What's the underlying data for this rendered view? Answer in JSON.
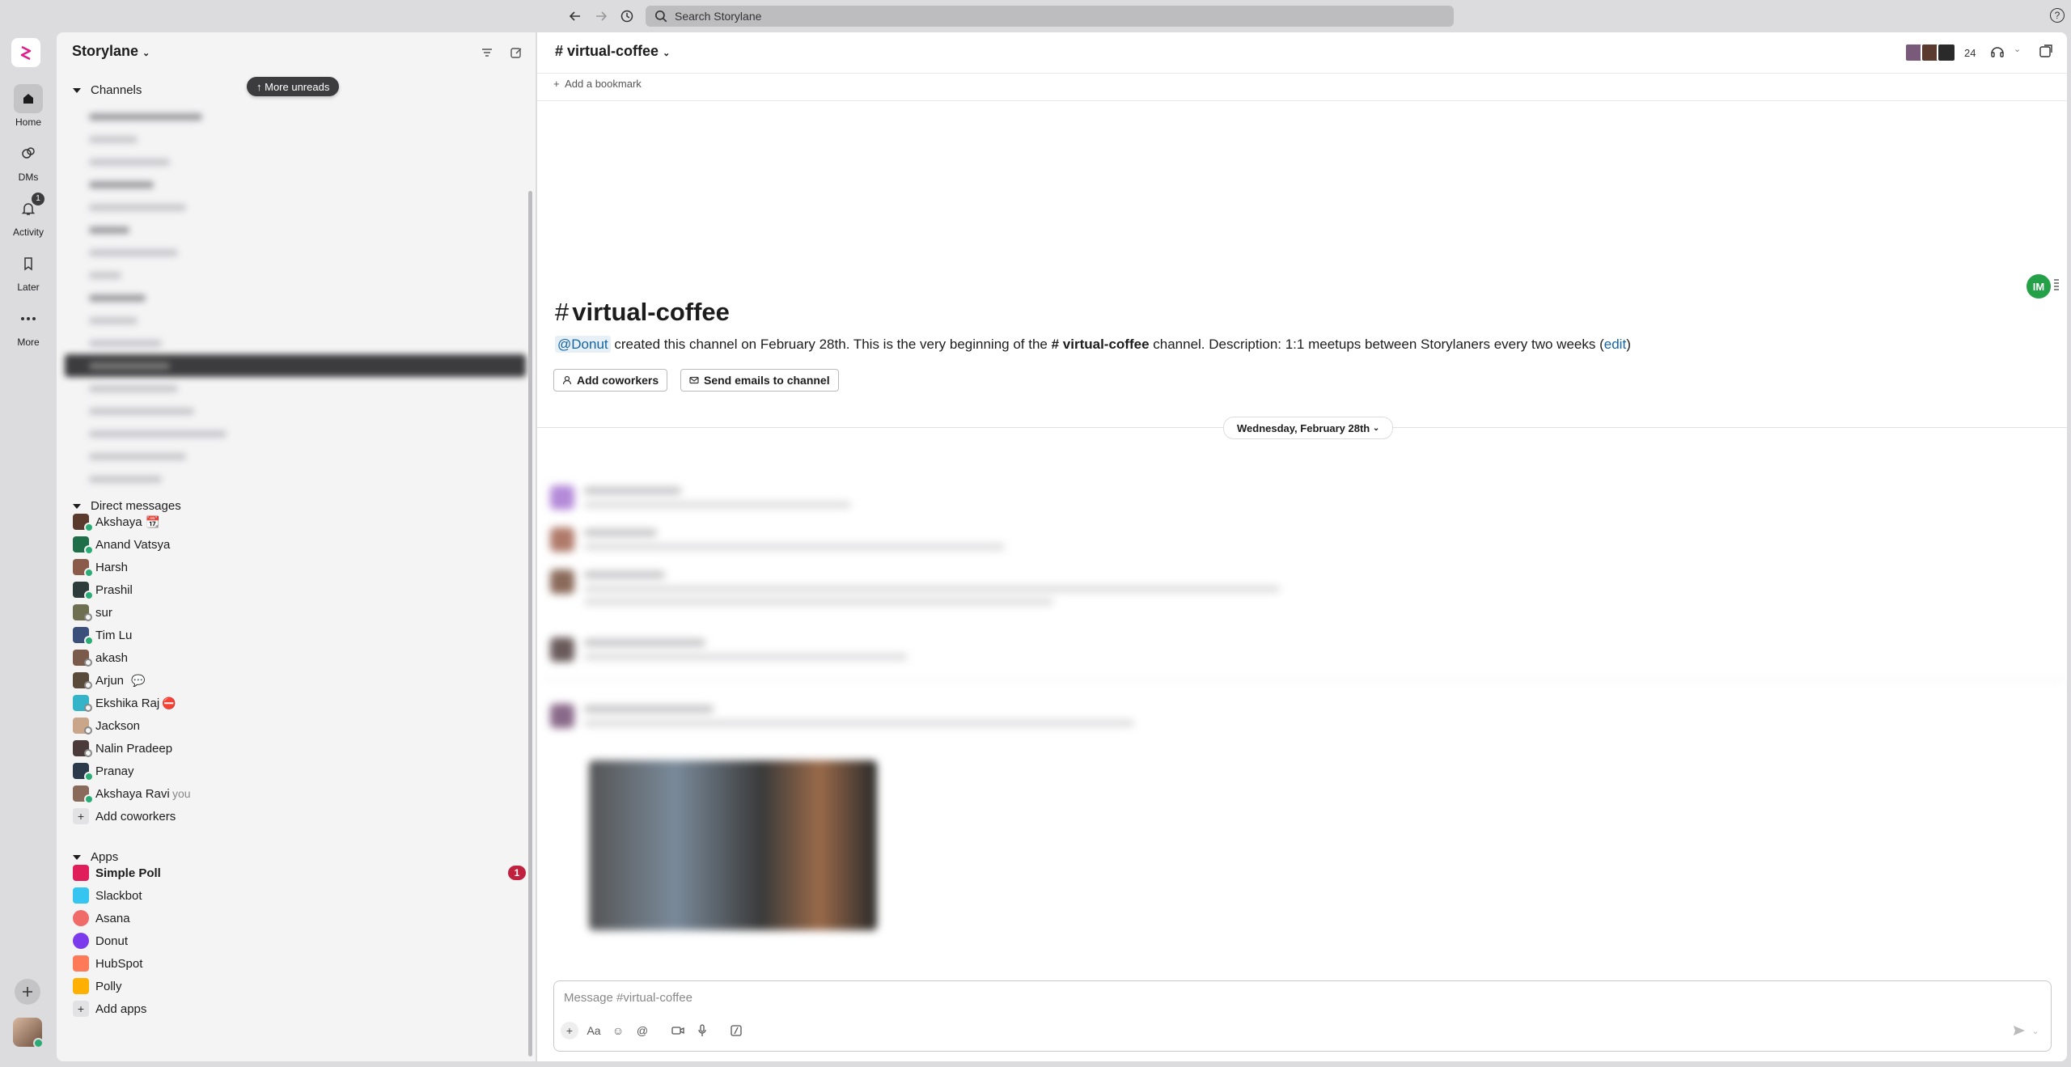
{
  "topbar": {
    "search_placeholder": "Search Storylane"
  },
  "rail": {
    "items": [
      {
        "label": "Home"
      },
      {
        "label": "DMs"
      },
      {
        "label": "Activity",
        "badge": "1"
      },
      {
        "label": "Later"
      },
      {
        "label": "More"
      }
    ]
  },
  "sidebar": {
    "workspace": "Storylane",
    "more_unreads": "↑ More unreads",
    "channels_header": "Channels",
    "dm_header": "Direct messages",
    "dms": [
      {
        "name": "Akshaya",
        "suffix": "📆"
      },
      {
        "name": "Anand Vatsya",
        "suffix": ""
      },
      {
        "name": "Harsh",
        "suffix": ""
      },
      {
        "name": "Prashil",
        "suffix": ""
      },
      {
        "name": "sur",
        "suffix": ""
      },
      {
        "name": "Tim Lu",
        "suffix": ""
      },
      {
        "name": "akash",
        "suffix": ""
      },
      {
        "name": "Arjun",
        "suffix": "💬"
      },
      {
        "name": "Ekshika Raj",
        "suffix": "⛔"
      },
      {
        "name": "Jackson",
        "suffix": ""
      },
      {
        "name": "Nalin Pradeep",
        "suffix": ""
      },
      {
        "name": "Pranay",
        "suffix": ""
      },
      {
        "name": "Akshaya Ravi",
        "suffix": "you"
      }
    ],
    "add_coworkers": "Add coworkers",
    "apps_header": "Apps",
    "apps": [
      {
        "name": "Simple Poll",
        "badge": "1",
        "color": "#e01e5a"
      },
      {
        "name": "Slackbot",
        "color": "#36c5f0"
      },
      {
        "name": "Asana",
        "color": "#f06a6a"
      },
      {
        "name": "Donut",
        "color": "#7c3aed"
      },
      {
        "name": "HubSpot",
        "color": "#ff7a59"
      },
      {
        "name": "Polly",
        "color": "#ffb000"
      }
    ],
    "add_apps": "Add apps"
  },
  "channel": {
    "header_title": "# virtual-coffee",
    "member_count": "24",
    "add_bookmark": "Add a bookmark",
    "intro_title": "virtual-coffee",
    "intro_mention": "@Donut",
    "intro_mid": " created this channel on February 28th. This is the very beginning of the ",
    "intro_channel": "# virtual-coffee",
    "intro_end": " channel. Description: 1:1 meetups between Storylaners every two weeks (",
    "intro_edit": "edit",
    "intro_close": ")",
    "add_coworkers_btn": "Add coworkers",
    "send_emails_btn": "Send emails to channel",
    "date_divider": "Wednesday, February 28th",
    "composer_placeholder": "Message #virtual-coffee"
  },
  "floating_badge": "IM",
  "accent": "#4a154b"
}
